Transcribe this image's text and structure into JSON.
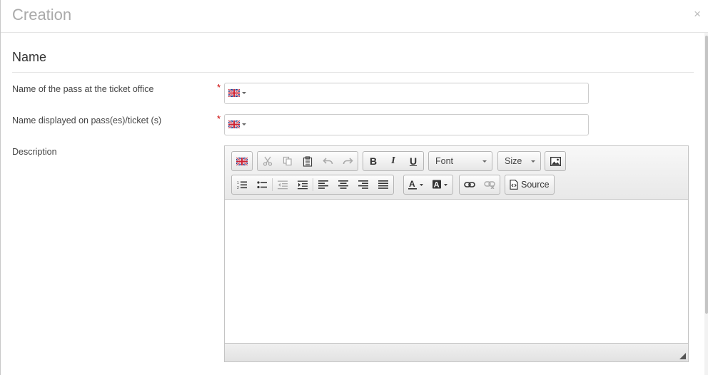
{
  "dialog": {
    "title": "Creation",
    "close_symbol": "×"
  },
  "section": {
    "title": "Name"
  },
  "fields": {
    "ticket_office_name": {
      "label": "Name of the pass at the ticket office",
      "value": "",
      "required": true,
      "language": "uk-flag-icon"
    },
    "displayed_name": {
      "label": "Name displayed on pass(es)/ticket (s)",
      "value": "",
      "required": true,
      "language": "uk-flag-icon"
    },
    "description": {
      "label": "Description",
      "content": ""
    }
  },
  "required_marker": "*",
  "editor": {
    "font_label": "Font",
    "size_label": "Size",
    "source_label": "Source",
    "bold": "B",
    "italic": "I",
    "underline": "U",
    "icons": [
      "uk-flag-icon",
      "cut-icon",
      "copy-icon",
      "paste-icon",
      "undo-icon",
      "redo-icon",
      "bold-icon",
      "italic-icon",
      "underline-icon",
      "image-icon",
      "numbered-list-icon",
      "bullet-list-icon",
      "outdent-icon",
      "indent-icon",
      "align-left-icon",
      "align-center-icon",
      "align-right-icon",
      "justify-icon",
      "text-color-icon",
      "background-color-icon",
      "link-icon",
      "unlink-icon",
      "source-icon"
    ]
  },
  "colors": {
    "required": "#cc0000",
    "border": "#c4c4c4",
    "title": "#aaaaaa"
  }
}
